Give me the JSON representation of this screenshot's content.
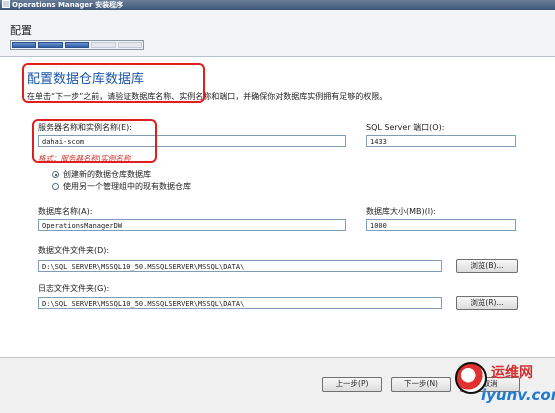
{
  "window": {
    "title": "Operations Manager 安装程序"
  },
  "header": {
    "title": "配置",
    "progress": {
      "total": 5,
      "completed": 3
    }
  },
  "page": {
    "title": "配置数据仓库数据库",
    "description": "在单击“下一步”之前，请验证数据库名称、实例名称和端口，并确保你对数据库实例拥有足够的权限。"
  },
  "server": {
    "label": "服务器名称和实例名称(E):",
    "value": "dahai-scom",
    "hint": "格式：服务器名称\\实例名称"
  },
  "port": {
    "label": "SQL Server 端口(O):",
    "value": "1433"
  },
  "options": [
    {
      "label": "创建新的数据仓库数据库",
      "checked": true
    },
    {
      "label": "使用另一个管理组中的现有数据仓库",
      "checked": false
    }
  ],
  "database_name": {
    "label": "数据库名称(A):",
    "value": "OperationsManagerDW"
  },
  "database_size": {
    "label": "数据库大小(MB)(I):",
    "value": "1000"
  },
  "data_folder": {
    "label": "数据文件文件夹(D):",
    "value": "D:\\SQL SERVER\\MSSQL10_50.MSSQLSERVER\\MSSQL\\DATA\\",
    "browse_label": "浏览(B)..."
  },
  "log_folder": {
    "label": "日志文件文件夹(G):",
    "value": "D:\\SQL SERVER\\MSSQL10_50.MSSQLSERVER\\MSSQL\\DATA\\",
    "browse_label": "浏览(R)..."
  },
  "footer": {
    "previous_label": "上一步(P)",
    "next_label": "下一步(N)",
    "cancel_label": "取消"
  },
  "watermark": {
    "text": "运维网",
    "url": "iyunv.com"
  },
  "colors": {
    "accent": "#1d57a8",
    "annotation": "#e02020",
    "hint": "#d0342c"
  }
}
